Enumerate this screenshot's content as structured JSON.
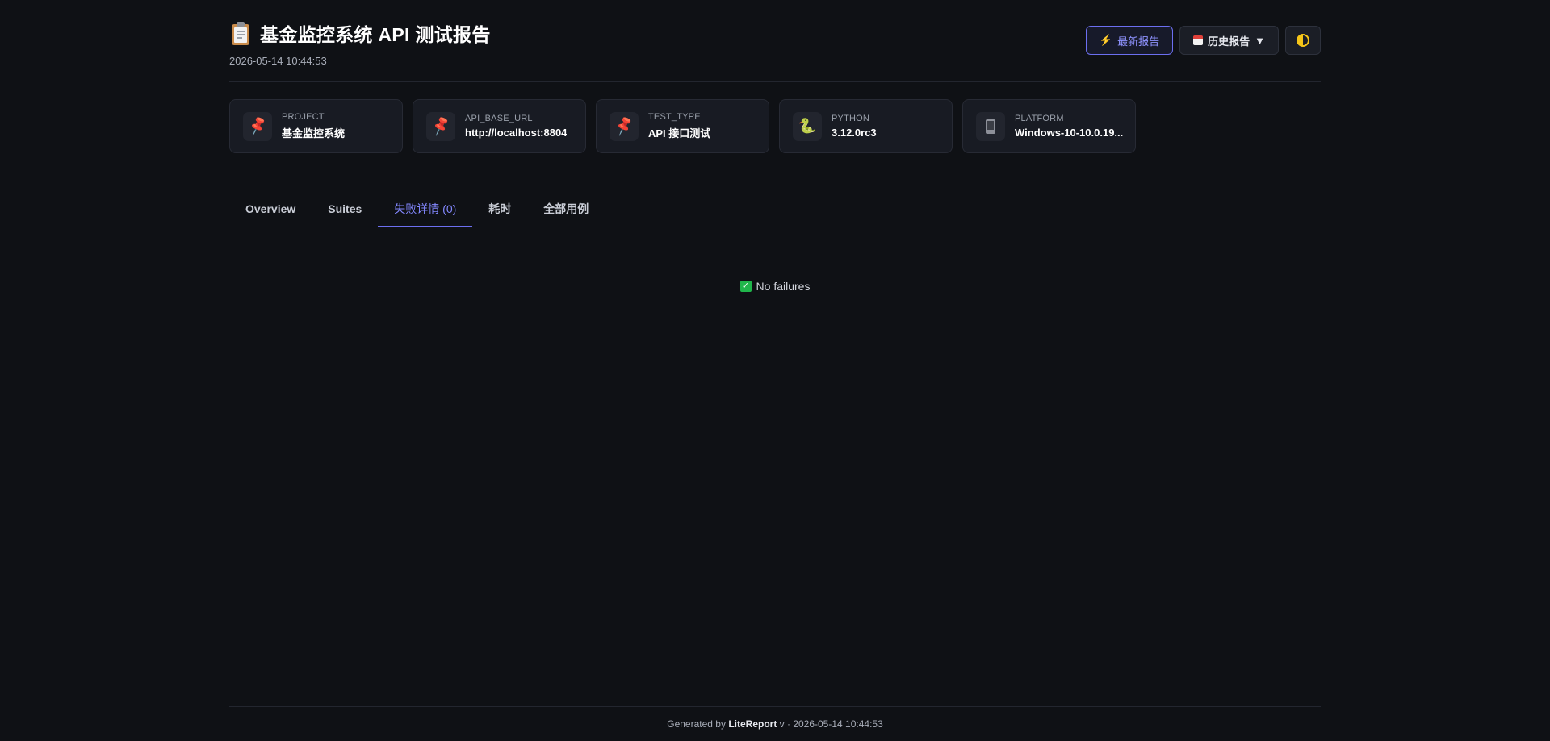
{
  "header": {
    "title": "基金监控系统 API 测试报告",
    "timestamp": "2026-05-14 10:44:53",
    "title_icon": "clipboard-icon"
  },
  "actions": {
    "latest_label": "最新报告",
    "history_label": "历史报告",
    "history_caret": "▼",
    "latest_icon": "bolt-icon",
    "history_icon": "calendar-icon",
    "theme_icon": "theme-toggle-icon"
  },
  "env": [
    {
      "label": "PROJECT",
      "value": "基金监控系统",
      "icon": "pin-icon"
    },
    {
      "label": "API_BASE_URL",
      "value": "http://localhost:8804",
      "icon": "pin-icon"
    },
    {
      "label": "TEST_TYPE",
      "value": "API 接口测试",
      "icon": "pin-icon"
    },
    {
      "label": "PYTHON",
      "value": "3.12.0rc3",
      "icon": "python-icon"
    },
    {
      "label": "PLATFORM",
      "value": "Windows-10-10.0.19...",
      "icon": "device-icon"
    }
  ],
  "tabs": [
    {
      "label": "Overview"
    },
    {
      "label": "Suites"
    },
    {
      "label": "失败详情 (0)",
      "active": true
    },
    {
      "label": "耗时"
    },
    {
      "label": "全部用例"
    }
  ],
  "content": {
    "empty_message": "No failures",
    "empty_icon": "check-icon"
  },
  "footer": {
    "prefix": "Generated by",
    "brand": "LiteReport",
    "suffix": "v · 2026-05-14 10:44:53"
  },
  "colors": {
    "background": "#0f1115",
    "accent": "#6c6ff0",
    "success": "#20b64b"
  }
}
